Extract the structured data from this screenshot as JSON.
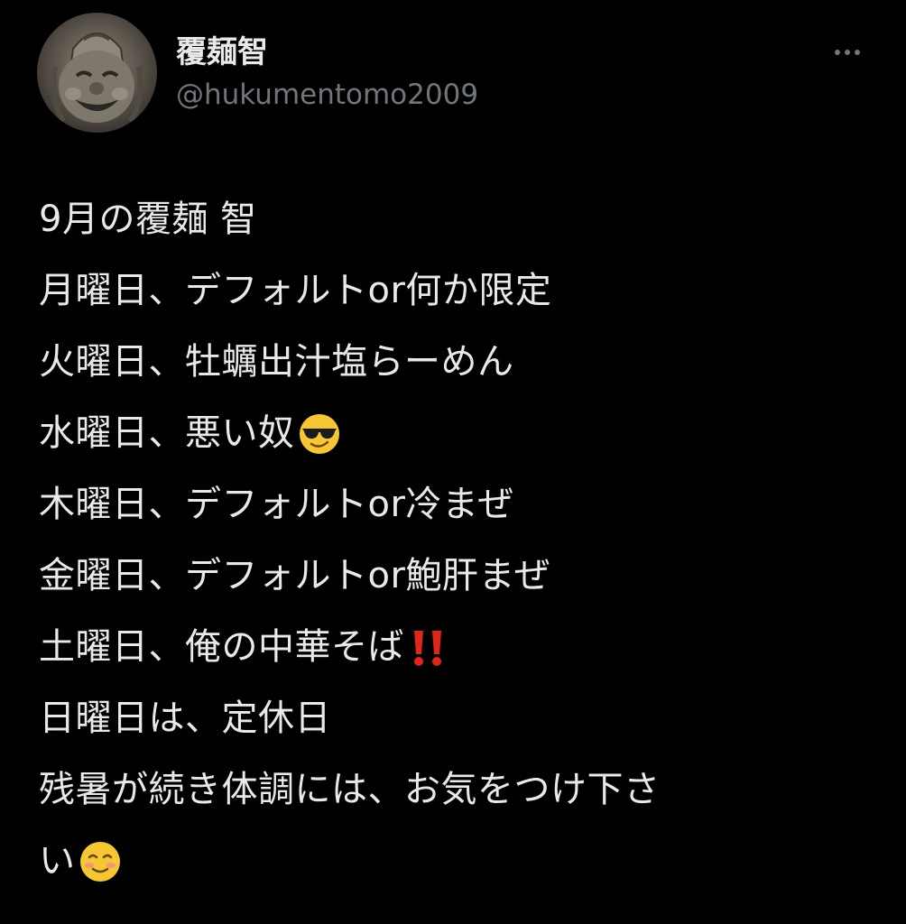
{
  "user": {
    "display_name": "覆麺智",
    "handle": "@hukumentomo2009"
  },
  "more_menu": {
    "icon": "more-horizontal-icon"
  },
  "tweet": {
    "lines": [
      "9月の覆麺 智",
      "月曜日、デフォルトor何か限定",
      "火曜日、牡蠣出汁塩らーめん",
      "水曜日、悪い奴",
      "木曜日、デフォルトor冷まぜ",
      "金曜日、デフォルトor鮑肝まぜ",
      "土曜日、俺の中華そば",
      "日曜日は、定休日",
      "残暑が続き体調には、お気をつけ下さ",
      "い"
    ],
    "emojis": {
      "line_4": "sunglasses-face-emoji",
      "line_7": "double-exclamation-emoji",
      "line_10": "smiling-face-emoji"
    }
  },
  "colors": {
    "background": "#000000",
    "text": "#e7e9ea",
    "secondary": "#71767b",
    "exclamation": "#e0251b",
    "emoji_face": "#f7c634"
  }
}
